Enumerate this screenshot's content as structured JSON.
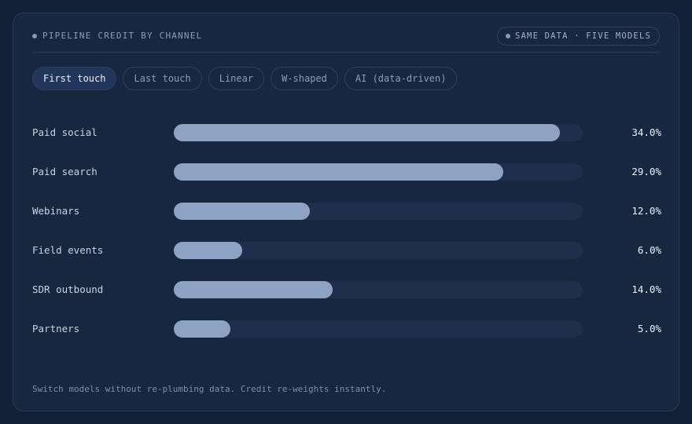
{
  "header": {
    "title": "PIPELINE CREDIT BY CHANNEL",
    "badge": "SAME DATA · FIVE MODELS"
  },
  "tabs": [
    {
      "label": "First touch",
      "active": true
    },
    {
      "label": "Last touch",
      "active": false
    },
    {
      "label": "Linear",
      "active": false
    },
    {
      "label": "W-shaped",
      "active": false
    },
    {
      "label": "AI (data-driven)",
      "active": false
    }
  ],
  "chart_data": {
    "type": "bar",
    "orientation": "horizontal",
    "max": 36,
    "categories": [
      "Paid social",
      "Paid search",
      "Webinars",
      "Field events",
      "SDR outbound",
      "Partners"
    ],
    "values": [
      34.0,
      29.0,
      12.0,
      6.0,
      14.0,
      5.0
    ],
    "value_labels": [
      "34.0%",
      "29.0%",
      "12.0%",
      "6.0%",
      "14.0%",
      "5.0%"
    ]
  },
  "footer": {
    "note": "Switch models without re-plumbing data. Credit re-weights instantly."
  },
  "colors": {
    "background": "#122037",
    "card": "#172740",
    "bar_fill": "#8ea3c4",
    "bar_track": "#1f2f4b"
  }
}
